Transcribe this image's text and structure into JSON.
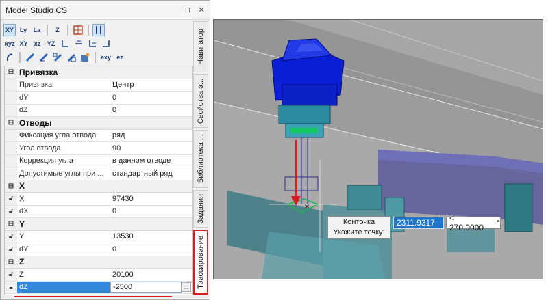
{
  "palette": {
    "title": "Model Studio CS",
    "pin_glyph": "⊓",
    "close_glyph": "✕"
  },
  "toolbar1": [
    "XY",
    "Ly",
    "La",
    "Z"
  ],
  "toolbar2": [
    "xyz",
    "XY",
    "xz",
    "YZ"
  ],
  "toolbar3": [
    "exy",
    "ez"
  ],
  "sections": [
    {
      "label": "Привязка"
    },
    {
      "label": "Отводы"
    },
    {
      "label": "X"
    },
    {
      "label": "Y"
    },
    {
      "label": "Z"
    }
  ],
  "rows": {
    "snap": {
      "name": "Привязка",
      "value": "Центр"
    },
    "dy1": {
      "name": "dY",
      "value": "0"
    },
    "dz1": {
      "name": "dZ",
      "value": "0"
    },
    "fix": {
      "name": "Фиксация угла отвода",
      "value": "ряд"
    },
    "angle": {
      "name": "Угол отвода",
      "value": "90"
    },
    "corr": {
      "name": "Коррекция угла",
      "value": "в данном отводе"
    },
    "allowed": {
      "name": "Допустимые углы при ...",
      "value": "стандартный ряд"
    },
    "x": {
      "name": "X",
      "value": "97430"
    },
    "dx": {
      "name": "dX",
      "value": "0"
    },
    "y": {
      "name": "Y",
      "value": "13530"
    },
    "dy2": {
      "name": "dY",
      "value": "0"
    },
    "z": {
      "name": "Z",
      "value": "20100"
    },
    "dz2": {
      "name": "dZ",
      "value": "-2500"
    }
  },
  "tabs": [
    "Навигатор",
    "Свойства э...",
    "Библиотека ...",
    "Задания",
    "Трассирование"
  ],
  "viewport": {
    "tooltip_line1": "Конточка",
    "tooltip_line2": "Укажите точку:",
    "coord_value": "2311.9317",
    "angle_value": "< 270.0000",
    "degree_sign": "°"
  },
  "colors": {
    "highlight": "#d42020",
    "selection": "#3388dd",
    "input_blue": "#1f74c8"
  }
}
